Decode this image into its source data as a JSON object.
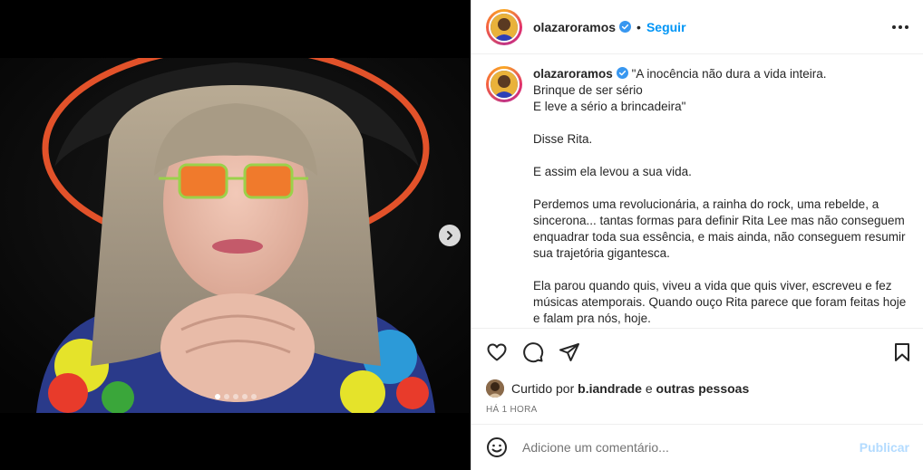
{
  "media": {
    "carousel_dots": 5,
    "active_dot": 0
  },
  "header": {
    "username": "olazaroramos",
    "separator": "•",
    "follow_label": "Seguir"
  },
  "caption": {
    "username": "olazaroramos",
    "text": "\"A inocência não dura a vida inteira.\nBrinque de ser sério\nE leve a sério a brincadeira\"\n\nDisse Rita.\n\nE assim ela levou a sua vida.\n\nPerdemos uma revolucionária, a rainha do rock, uma rebelde, a sincerona... tantas formas para definir Rita Lee mas não conseguem enquadrar toda sua essência, e mais ainda, não conseguem resumir sua trajetória gigantesca.\n\nEla parou quando quis, viveu a vida que quis viver, escreveu e fez músicas atemporais. Quando ouço Rita parece que foram feitas hoje e falam pra nós, hoje."
  },
  "likes": {
    "prefix": "Curtido por",
    "user": "b.iandrade",
    "conj": "e",
    "others": "outras pessoas"
  },
  "time": "HÁ 1 HORA",
  "comment": {
    "placeholder": "Adicione um comentário...",
    "publish_label": "Publicar"
  },
  "colors": {
    "accent": "#0095f6",
    "verified": "#3897f0",
    "publish_disabled": "#b3dbff"
  }
}
